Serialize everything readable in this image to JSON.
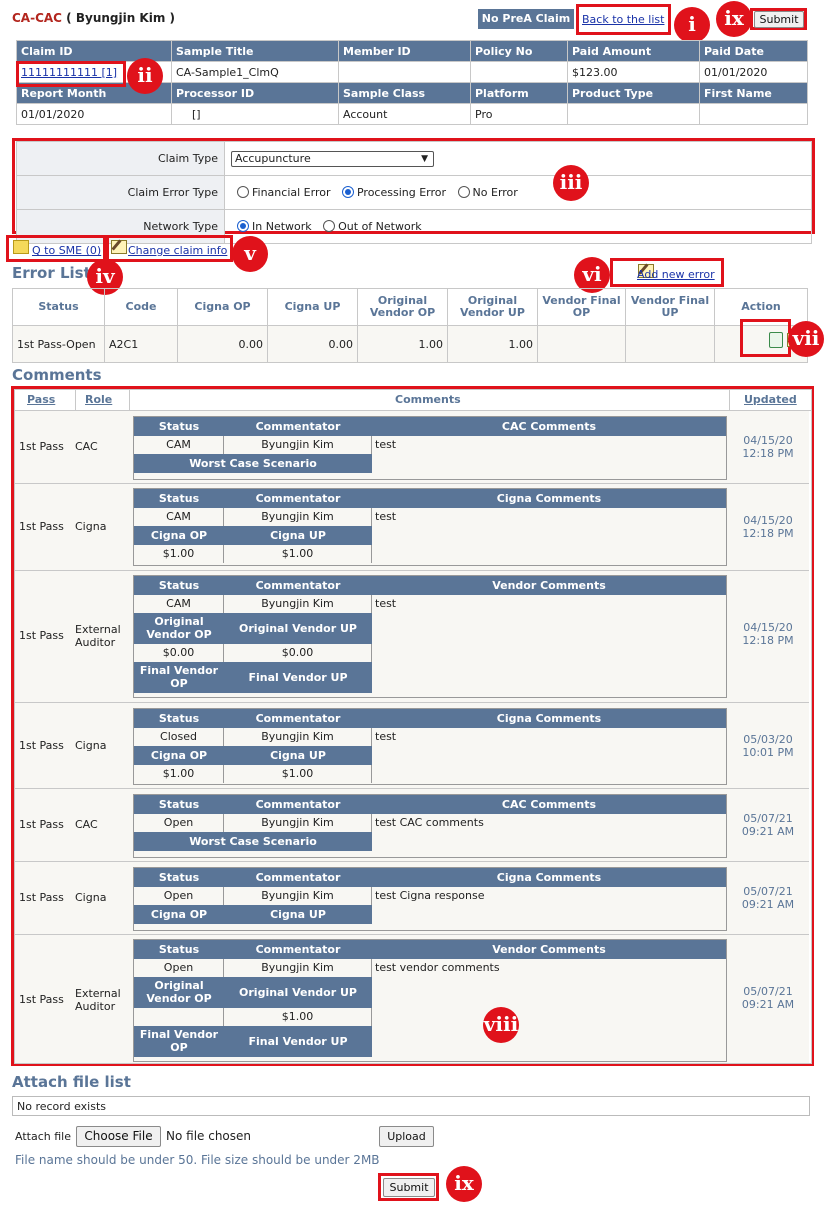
{
  "header": {
    "code": "CA-CAC",
    "name_open": "(",
    "name": "Byungjin Kim",
    "name_close": ")",
    "no_prea": "No PreA Claim",
    "back": "Back to the list",
    "submit": "Submit"
  },
  "markers": {
    "i": "i",
    "ii": "ii",
    "iii": "iii",
    "iv": "iv",
    "v": "v",
    "vi": "vi",
    "vii": "vii",
    "viii": "viii",
    "ix": "ix"
  },
  "info": {
    "row1_headers": [
      "Claim ID",
      "Sample Title",
      "Member ID",
      "Policy No",
      "Paid Amount",
      "Paid Date"
    ],
    "row1_values": [
      "11111111111 [1]",
      "CA-Sample1_ClmQ",
      "",
      "",
      "$123.00",
      "01/01/2020"
    ],
    "row2_headers": [
      "Report Month",
      "Processor ID",
      "Sample Class",
      "Platform",
      "Product Type",
      "First Name"
    ],
    "row2_values": [
      "01/01/2020",
      "[]",
      "Account",
      "Pro",
      "",
      ""
    ]
  },
  "form": {
    "claim_type_label": "Claim Type",
    "claim_type_value": "Accupuncture",
    "error_type_label": "Claim Error Type",
    "error_opts": [
      "Financial Error",
      "Processing Error",
      "No Error"
    ],
    "error_selected": 1,
    "network_label": "Network Type",
    "network_opts": [
      "In Network",
      "Out of Network"
    ],
    "network_selected": 0
  },
  "links": {
    "sme": "Q to SME (0)",
    "change": "Change claim info",
    "add_error": "Add new error"
  },
  "error_list": {
    "title": "Error List",
    "headers": [
      "Status",
      "Code",
      "Cigna OP",
      "Cigna UP",
      "Original Vendor OP",
      "Original Vendor UP",
      "Vendor Final OP",
      "Vendor Final UP",
      "Action"
    ],
    "row": [
      "1st Pass-Open",
      "A2C1",
      "0.00",
      "0.00",
      "1.00",
      "1.00",
      "",
      ""
    ]
  },
  "comments": {
    "title": "Comments",
    "headers": {
      "pass": "Pass",
      "role": "Role",
      "comments": "Comments",
      "updated": "Updated"
    },
    "labels": {
      "status": "Status",
      "commentator": "Commentator",
      "cigna_op": "Cigna OP",
      "cigna_up": "Cigna UP",
      "orig_vop": "Original Vendor OP",
      "orig_vup": "Original Vendor UP",
      "final_vop": "Final Vendor OP",
      "final_vup": "Final Vendor UP",
      "worst": "Worst Case Scenario"
    },
    "rows": [
      {
        "pass": "1st Pass",
        "role": "CAC",
        "kind": "CAC Comments",
        "status": "CAM",
        "commentator": "Byungjin Kim",
        "text": "test",
        "date": "04/15/20",
        "time": "12:18 PM"
      },
      {
        "pass": "1st Pass",
        "role": "Cigna",
        "kind": "Cigna Comments",
        "status": "CAM",
        "commentator": "Byungjin Kim",
        "text": "test",
        "op": "$1.00",
        "up": "$1.00",
        "date": "04/15/20",
        "time": "12:18 PM"
      },
      {
        "pass": "1st Pass",
        "role1": "External",
        "role2": "Auditor",
        "kind": "Vendor Comments",
        "status": "CAM",
        "commentator": "Byungjin Kim",
        "text": "test",
        "op": "$0.00",
        "up": "$0.00",
        "date": "04/15/20",
        "time": "12:18 PM"
      },
      {
        "pass": "1st Pass",
        "role": "Cigna",
        "kind": "Cigna Comments",
        "status": "Closed",
        "commentator": "Byungjin Kim",
        "text": "test",
        "op": "$1.00",
        "up": "$1.00",
        "date": "05/03/20",
        "time": "10:01 PM"
      },
      {
        "pass": "1st Pass",
        "role": "CAC",
        "kind": "CAC Comments",
        "status": "Open",
        "commentator": "Byungjin Kim",
        "text": "test CAC comments",
        "date": "05/07/21",
        "time": "09:21 AM"
      },
      {
        "pass": "1st Pass",
        "role": "Cigna",
        "kind": "Cigna Comments",
        "status": "Open",
        "commentator": "Byungjin Kim",
        "text": "test Cigna response",
        "date": "05/07/21",
        "time": "09:21 AM"
      },
      {
        "pass": "1st Pass",
        "role1": "External",
        "role2": "Auditor",
        "kind": "Vendor Comments",
        "status": "Open",
        "commentator": "Byungjin Kim",
        "text": "test vendor comments",
        "op": "",
        "up": "$1.00",
        "date": "05/07/21",
        "time": "09:21 AM"
      }
    ]
  },
  "attach": {
    "title": "Attach file list",
    "empty": "No record exists",
    "label": "Attach file",
    "choose": "Choose File",
    "nofile": "No file chosen",
    "upload": "Upload",
    "note": "File name should be under 50. File size should be under 2MB",
    "submit": "Submit"
  }
}
